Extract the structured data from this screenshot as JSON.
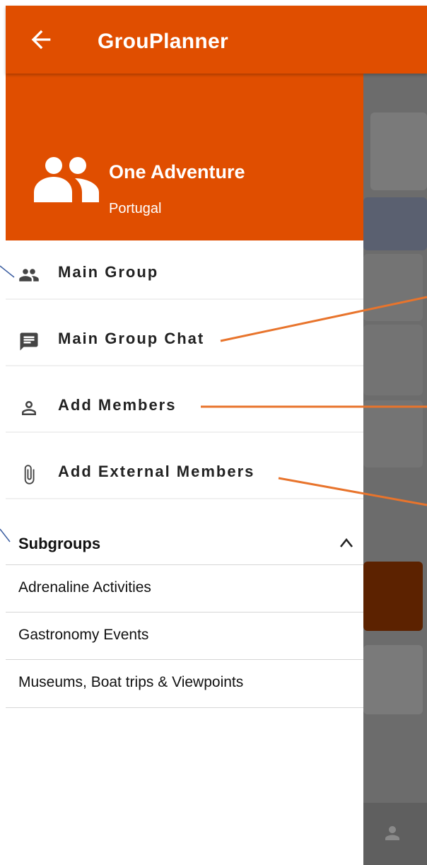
{
  "app": {
    "title": "GrouPlanner"
  },
  "drawer": {
    "group_name": "One Adventure",
    "group_country": "Portugal",
    "menu": [
      {
        "label": "Main Group",
        "icon": "group-icon"
      },
      {
        "label": "Main Group Chat",
        "icon": "chat-icon"
      },
      {
        "label": "Add Members",
        "icon": "person-icon"
      },
      {
        "label": "Add External Members",
        "icon": "paperclip-icon"
      }
    ],
    "subgroups": {
      "label": "Subgroups",
      "expanded": true,
      "items": [
        "Adrenaline Activities",
        "Gastronomy Events",
        "Museums, Boat trips & Viewpoints"
      ]
    }
  },
  "colors": {
    "brand": "#E04E00",
    "overlay": "#6c6c6c",
    "annotation_line": "#E8742C"
  }
}
